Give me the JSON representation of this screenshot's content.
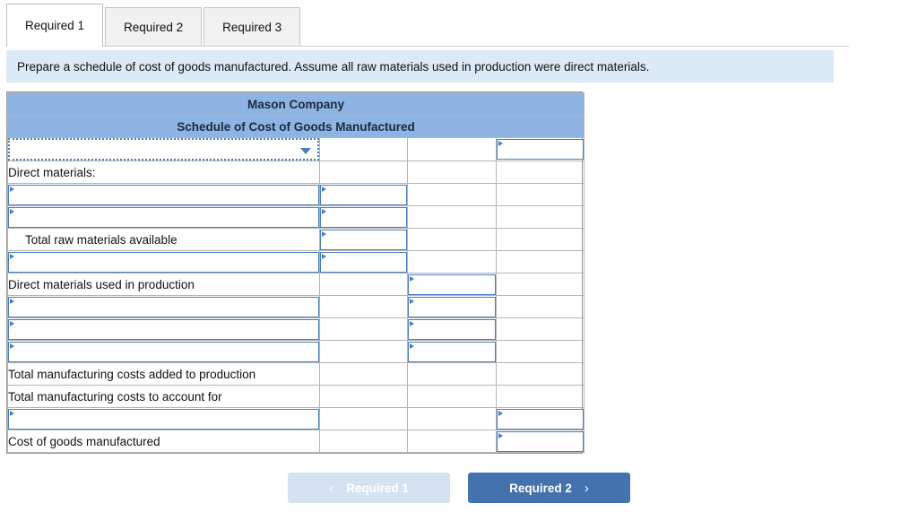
{
  "tabs": [
    {
      "label": "Required 1",
      "active": true
    },
    {
      "label": "Required 2",
      "active": false
    },
    {
      "label": "Required 3",
      "active": false
    }
  ],
  "banner": {
    "text": "Prepare a schedule of cost of goods manufactured. Assume all raw materials used in production were direct materials."
  },
  "sheet": {
    "title_line1": "Mason Company",
    "title_line2": "Schedule of Cost of Goods Manufactured",
    "rows": [
      {
        "label": "",
        "type": "select",
        "value": "",
        "cols": [
          false,
          false,
          true
        ]
      },
      {
        "label": "Direct materials:",
        "type": "text",
        "cols": [
          false,
          false,
          false
        ]
      },
      {
        "label": "",
        "type": "input",
        "value": "",
        "cols": [
          true,
          false,
          false
        ]
      },
      {
        "label": "",
        "type": "input",
        "value": "",
        "cols": [
          true,
          false,
          false
        ]
      },
      {
        "label": "Total raw materials available",
        "type": "text",
        "cols": [
          true,
          false,
          false
        ]
      },
      {
        "label": "",
        "type": "input",
        "value": "",
        "cols": [
          true,
          false,
          false
        ]
      },
      {
        "label": "Direct materials used in production",
        "type": "text",
        "cols": [
          false,
          true,
          false
        ]
      },
      {
        "label": "",
        "type": "input",
        "value": "",
        "cols": [
          false,
          true,
          false
        ]
      },
      {
        "label": "",
        "type": "input",
        "value": "",
        "cols": [
          false,
          true,
          false
        ]
      },
      {
        "label": "",
        "type": "input",
        "value": "",
        "cols": [
          false,
          true,
          false
        ]
      },
      {
        "label": "Total manufacturing costs added to production",
        "type": "text",
        "cols": [
          false,
          false,
          false
        ]
      },
      {
        "label": "Total manufacturing costs to account for",
        "type": "text",
        "cols": [
          false,
          false,
          false
        ]
      },
      {
        "label": "",
        "type": "input",
        "value": "",
        "cols": [
          false,
          false,
          true
        ]
      },
      {
        "label": "Cost of goods manufactured",
        "type": "text",
        "cols": [
          false,
          false,
          true
        ]
      }
    ]
  },
  "nav": {
    "prev_label": "Required 1",
    "next_label": "Required 2",
    "prev_chevron": "‹",
    "next_chevron": "›"
  },
  "colors": {
    "header_blue": "#8db4e2",
    "banner_blue": "#dce9f7",
    "input_border": "#4a7ebb",
    "total_rule": "#1f3864",
    "btn_active": "#4472ac",
    "btn_disabled": "#d6e2f2"
  }
}
